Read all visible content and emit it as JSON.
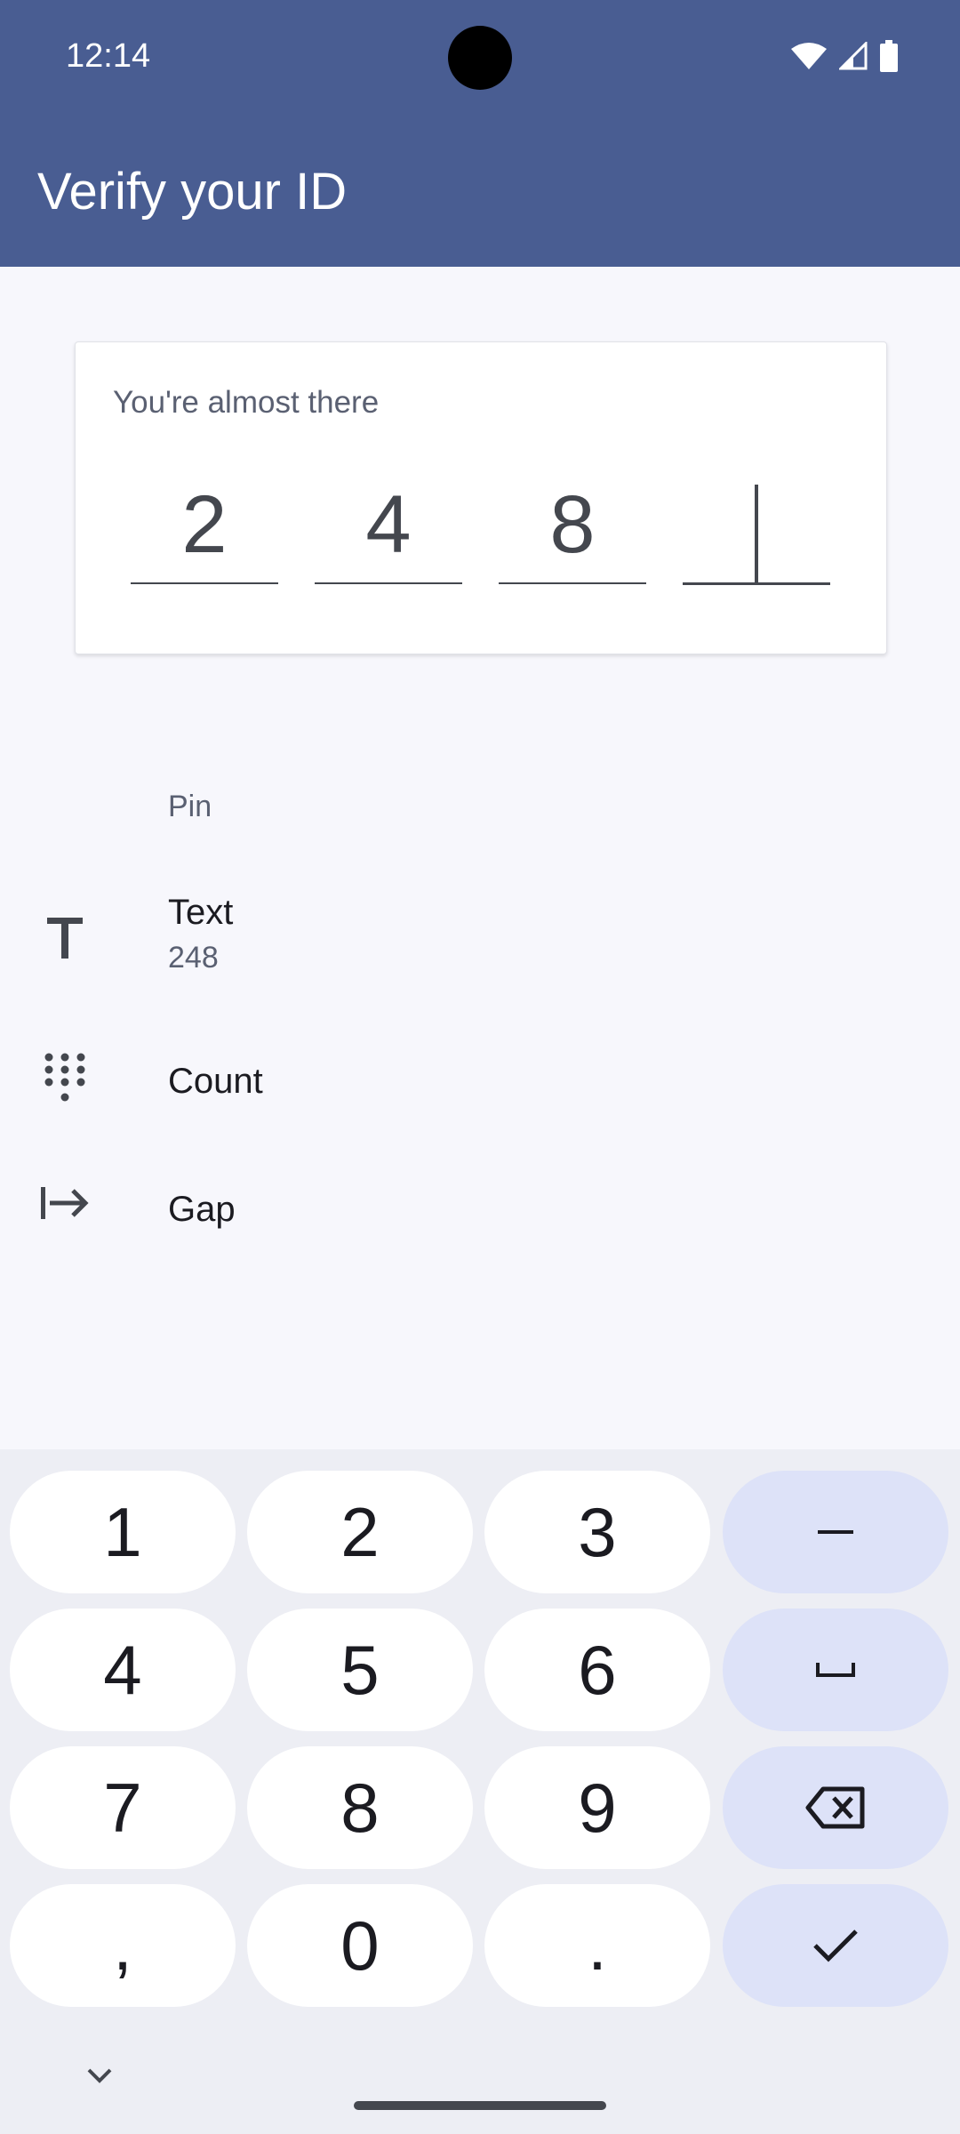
{
  "status_bar": {
    "time": "12:14",
    "icons": [
      "wifi-icon",
      "signal-icon",
      "battery-icon"
    ]
  },
  "app_bar": {
    "title": "Verify your ID"
  },
  "pin_card": {
    "label": "You're almost there",
    "digits": [
      "2",
      "4",
      "8",
      ""
    ]
  },
  "settings": {
    "section_label": "Pin",
    "items": [
      {
        "icon": "text-format-icon",
        "title": "Text",
        "subtitle": "248"
      },
      {
        "icon": "dialpad-icon",
        "title": "Count",
        "subtitle": ""
      },
      {
        "icon": "arrow-right-to-line-icon",
        "title": "Gap",
        "subtitle": ""
      }
    ]
  },
  "keyboard": {
    "keys": [
      [
        "1",
        "2",
        "3",
        "–"
      ],
      [
        "4",
        "5",
        "6",
        "space"
      ],
      [
        "7",
        "8",
        "9",
        "backspace"
      ],
      [
        ",",
        "0",
        ".",
        "done"
      ]
    ],
    "labels": {
      "k1": "1",
      "k2": "2",
      "k3": "3",
      "dash": "–",
      "k4": "4",
      "k5": "5",
      "k6": "6",
      "k7": "7",
      "k8": "8",
      "k9": "9",
      "comma": ",",
      "k0": "0",
      "period": "."
    }
  },
  "colors": {
    "app_bar": "#495d92",
    "background": "#f7f7fc",
    "keyboard_bg": "#edeef4",
    "function_key": "#dde2f8"
  }
}
